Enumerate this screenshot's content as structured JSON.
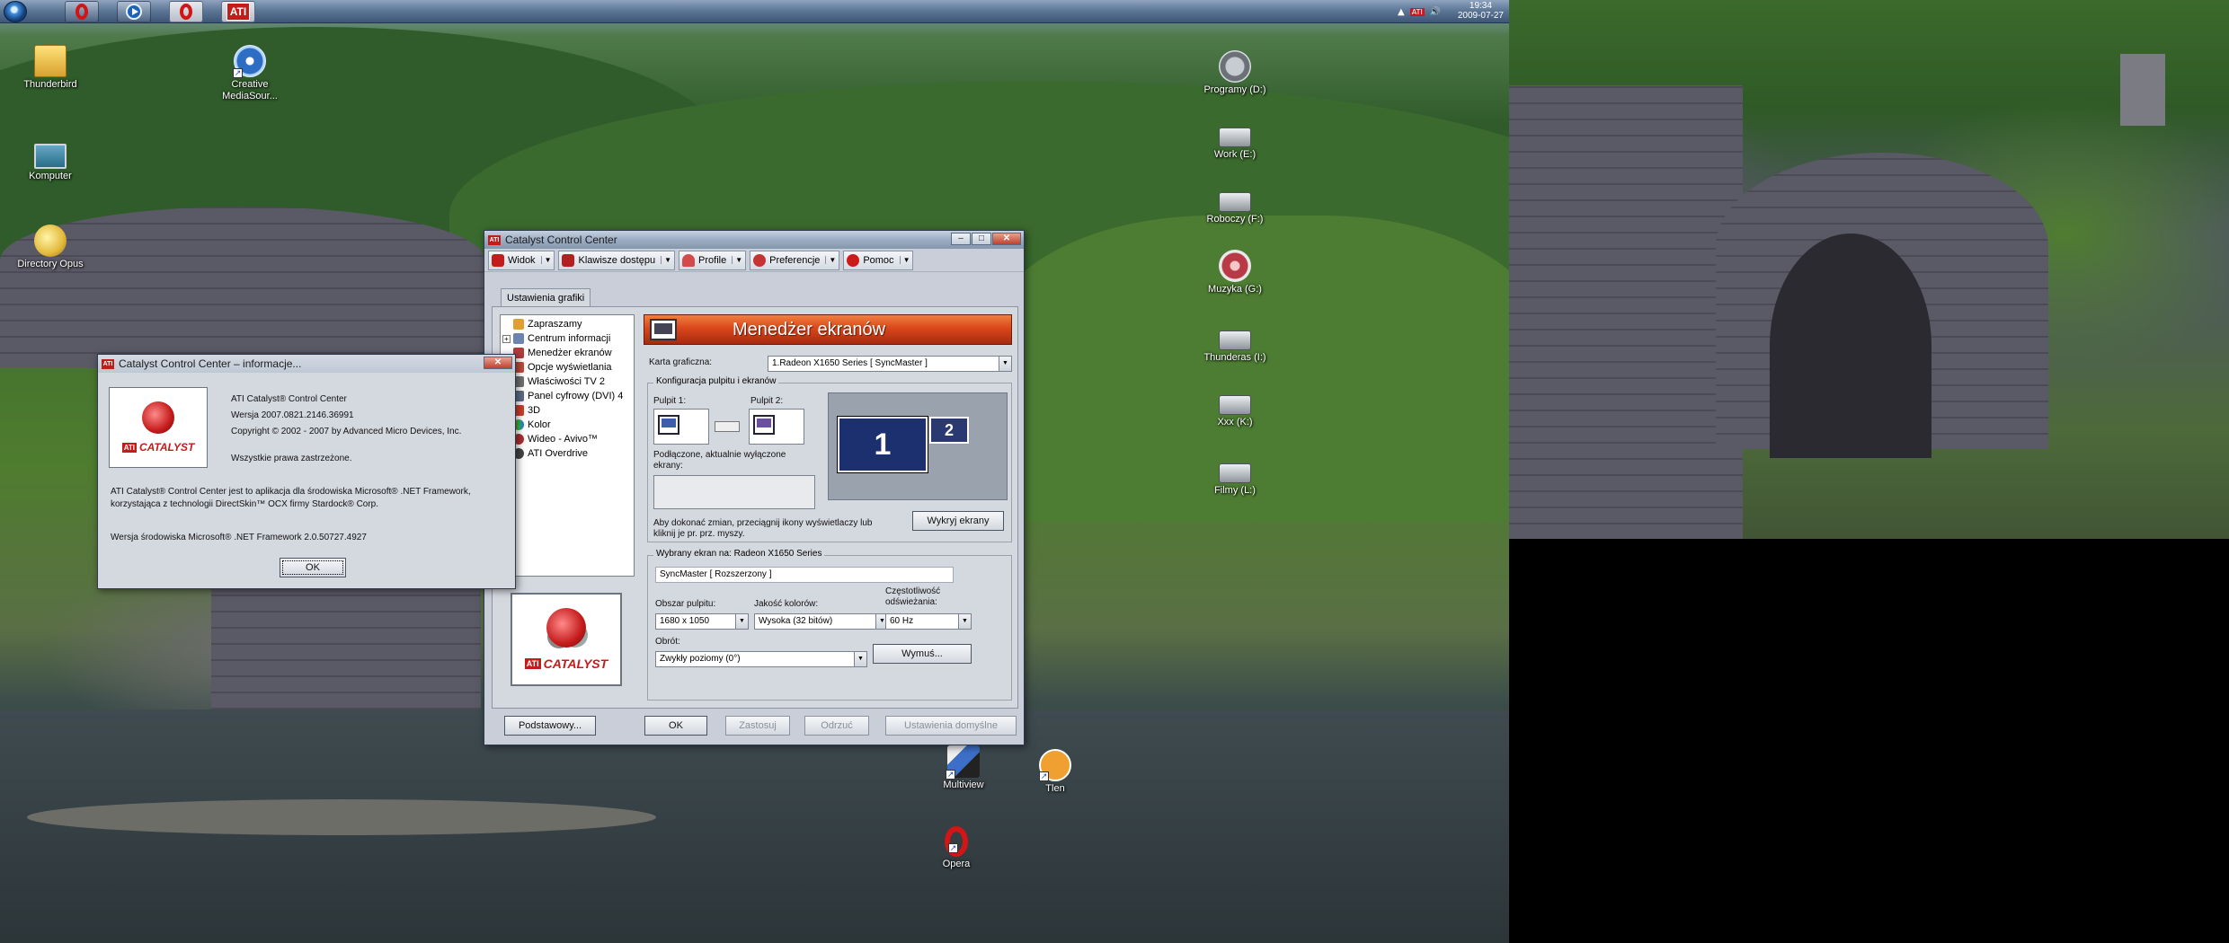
{
  "taskbar": {
    "buttons": [
      {
        "name": "opera",
        "label": ""
      },
      {
        "name": "media-source",
        "label": ""
      },
      {
        "name": "opera-2",
        "label": ""
      },
      {
        "name": "ati",
        "label": "ATI"
      }
    ],
    "clock": {
      "time": "19:34",
      "date": "2009-07-27"
    }
  },
  "desktop_icons": {
    "thunderbird": "Thunderbird",
    "creative": "Creative MediaSour...",
    "komputer": "Komputer",
    "directory_opus": "Directory Opus",
    "programy": "Programy (D:)",
    "work": "Work (E:)",
    "roboczy": "Roboczy (F:)",
    "muzyka": "Muzyka (G:)",
    "thunderas": "Thunderas (I:)",
    "xxx": "Xxx (K:)",
    "filmy": "Filmy (L:)",
    "multiview": "Multiview",
    "tlen": "Tlen",
    "opera": "Opera"
  },
  "ccc_window": {
    "title": "Catalyst Control Center",
    "menu": {
      "view": "Widok",
      "hotkeys": "Klawisze dostępu",
      "profiles": "Profile",
      "preferences": "Preferencje",
      "help": "Pomoc"
    },
    "tab": "Ustawienia grafiki",
    "tree": [
      {
        "label": "Zapraszamy",
        "expander": ""
      },
      {
        "label": "Centrum informacji",
        "expander": "+"
      },
      {
        "label": "Menedżer ekranów",
        "expander": ""
      },
      {
        "label": "Opcje wyświetlania",
        "expander": ""
      },
      {
        "label": "Właściwości TV 2",
        "expander": ""
      },
      {
        "label": "Panel cyfrowy (DVI) 4",
        "expander": ""
      },
      {
        "label": "3D",
        "expander": ""
      },
      {
        "label": "Kolor",
        "expander": ""
      },
      {
        "label": "Wideo - Avivo™",
        "expander": ""
      },
      {
        "label": "ATI Overdrive",
        "expander": ""
      }
    ],
    "header_title": "Menedżer ekranów",
    "graphics_card_label": "Karta graficzna:",
    "graphics_card_value": "1.Radeon X1650 Series [ SyncMaster ]",
    "config_group_title": "Konfiguracja pulpitu i ekranów",
    "desktop1_label": "Pulpit 1:",
    "desktop2_label": "Pulpit 2:",
    "connected_disabled_label": "Podłączone, aktualnie wyłączone ekrany:",
    "hint": "Aby dokonać zmian, przeciągnij ikony wyświetlaczy lub kliknij je pr. prz. myszy.",
    "detect_button": "Wykryj ekrany",
    "display_1": "1",
    "display_2": "2",
    "selected_group_title": "Wybrany ekran na: Radeon X1650 Series",
    "selected_display_value": "SyncMaster  [ Rozszerzony ]",
    "desktop_area_label": "Obszar pulpitu:",
    "desktop_area_value": "1680 x 1050",
    "color_quality_label": "Jakość kolorów:",
    "color_quality_value": "Wysoka (32 bitów)",
    "refresh_label": "Częstotliwość odświeżania:",
    "refresh_value": "60 Hz",
    "rotation_label": "Obrót:",
    "rotation_value": "Zwykły poziomy (0°)",
    "force_button": "Wymuś...",
    "buttons": {
      "basic": "Podstawowy...",
      "ok": "OK",
      "apply": "Zastosuj",
      "discard": "Odrzuć",
      "defaults": "Ustawienia domyślne"
    },
    "logo_text": "CATALYST",
    "logo_brand": "ATI"
  },
  "about_dialog": {
    "title": "Catalyst Control Center – informacje...",
    "product": "ATI Catalyst® Control Center",
    "version": "Wersja 2007.0821.2146.36991",
    "copyright": "Copyright © 2002 - 2007 by Advanced Micro Devices, Inc.",
    "rights": "Wszystkie prawa zastrzeżone.",
    "framework_note": "ATI Catalyst® Control Center jest to aplikacja dla środowiska Microsoft® .NET Framework, korzystająca z technologii DirectSkin™ OCX firmy Stardock® Corp.",
    "framework_version": "Wersja środowiska Microsoft® .NET Framework 2.0.50727.4927",
    "ok": "OK",
    "logo_text": "CATALYST",
    "logo_brand": "ATI"
  },
  "colors": {
    "ati_red": "#c41b1b",
    "header_orange": "#d9471b",
    "selected_display_blue": "#1c2f6e"
  }
}
